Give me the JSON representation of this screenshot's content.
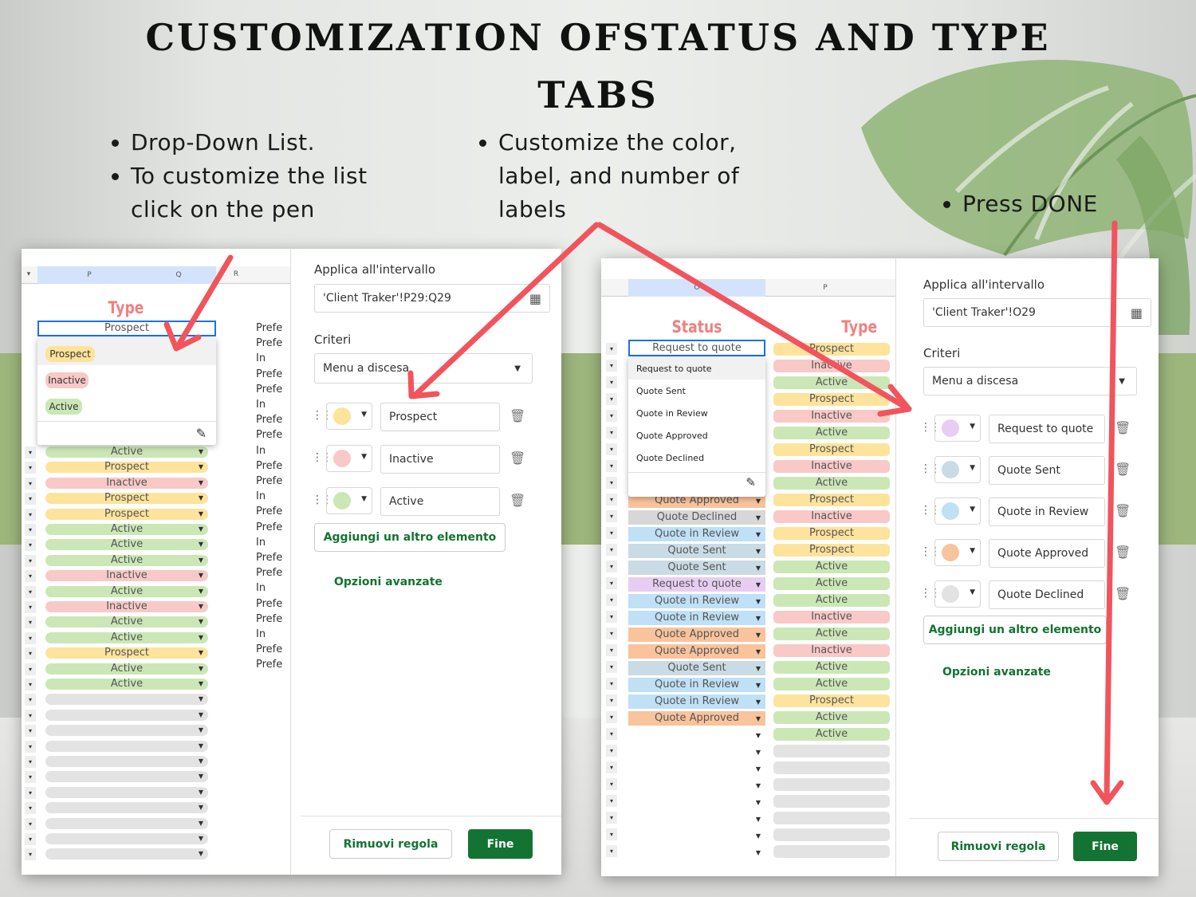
{
  "title": {
    "line1": "CUSTOMIZATION OFSTATUS AND TYPE",
    "line2": "TABS"
  },
  "bullets_left": [
    "Drop-Down List.",
    "To customize the list click on the pen"
  ],
  "bullets_mid": [
    "Customize the color, label, and number of labels"
  ],
  "bullets_right": [
    "Press DONE"
  ],
  "left_panel": {
    "col_headers": [
      "P",
      "Q",
      "R"
    ],
    "header": "Type",
    "selected_cell": "Prospect",
    "dropdown": [
      "Prospect",
      "Inactive",
      "Active"
    ],
    "rows": [
      "Active",
      "Prospect",
      "Inactive",
      "Prospect",
      "Prospect",
      "Active",
      "Active",
      "Active",
      "Inactive",
      "Active",
      "Inactive",
      "Active",
      "Active",
      "Prospect",
      "Active",
      "Active"
    ],
    "cut_col": [
      "Prefe",
      "Prefe",
      "In",
      "Prefe",
      "Prefe",
      "In",
      "Prefe",
      "Prefe",
      "In",
      "Prefe",
      "Prefe",
      "In",
      "Prefe",
      "Prefe",
      "In",
      "Prefe",
      "Prefe",
      "In",
      "Prefe",
      "Prefe",
      "In",
      "Prefe",
      "Prefe"
    ],
    "sidebar": {
      "apply_label": "Applica all'intervallo",
      "range": "'Client Traker'!P29:Q29",
      "criteria_label": "Criteri",
      "criteria": "Menu a discesa",
      "items": [
        {
          "label": "Prospect",
          "color": "#fde39b"
        },
        {
          "label": "Inactive",
          "color": "#f8c9c7"
        },
        {
          "label": "Active",
          "color": "#cbe7b6"
        }
      ],
      "add_item": "Aggiungi un altro elemento",
      "advanced": "Opzioni avanzate",
      "remove": "Rimuovi regola",
      "done": "Fine"
    }
  },
  "right_panel": {
    "col_headers": [
      "O",
      "P"
    ],
    "status_header": "Status",
    "type_header": "Type",
    "selected_cell": "Request to quote",
    "dropdown": [
      "Request to quote",
      "Quote Sent",
      "Quote in Review",
      "Quote Approved",
      "Quote Declined"
    ],
    "status_rows": [
      "Quote Approved",
      "Quote Declined",
      "Quote in Review",
      "Quote Sent",
      "Quote Sent",
      "Request to quote",
      "Quote in Review",
      "Quote in Review",
      "Quote Approved",
      "Quote Approved",
      "Quote Sent",
      "Quote in Review",
      "Quote in Review",
      "Quote Approved"
    ],
    "type_rows": [
      "Prospect",
      "Inactive",
      "Active",
      "Prospect",
      "Inactive",
      "Active",
      "Prospect",
      "Inactive",
      "Active",
      "Prospect",
      "Inactive",
      "Prospect",
      "Prospect",
      "Active",
      "Active",
      "Active",
      "Inactive",
      "Active",
      "Inactive",
      "Active",
      "Active",
      "Prospect",
      "Active",
      "Active"
    ],
    "sidebar": {
      "apply_label": "Applica all'intervallo",
      "range": "'Client Traker'!O29",
      "criteria_label": "Criteri",
      "criteria": "Menu a discesa",
      "items": [
        {
          "label": "Request to quote",
          "color": "#e8cdf2"
        },
        {
          "label": "Quote Sent",
          "color": "#c9dbe4"
        },
        {
          "label": "Quote in Review",
          "color": "#bfe0f5"
        },
        {
          "label": "Quote Approved",
          "color": "#f9c39c"
        },
        {
          "label": "Quote Declined",
          "color": "#e2e2e2"
        }
      ],
      "add_item": "Aggiungi un altro elemento",
      "advanced": "Opzioni avanzate",
      "remove": "Rimuovi regola",
      "done": "Fine"
    }
  },
  "chip_colors": {
    "Active": "#cbe7b6",
    "Prospect": "#fde39b",
    "Inactive": "#f8c9c7",
    "Request to quote": "#e8cdf2",
    "Quote Sent": "#c9dbe4",
    "Quote in Review": "#bfe0f5",
    "Quote Approved": "#f9c39c",
    "Quote Declined": "#d7d7d7",
    "empty": "#e3e3e3"
  },
  "accent": {
    "arrow": "#f1545c",
    "green": "#137333",
    "header_red": "#f08080"
  }
}
